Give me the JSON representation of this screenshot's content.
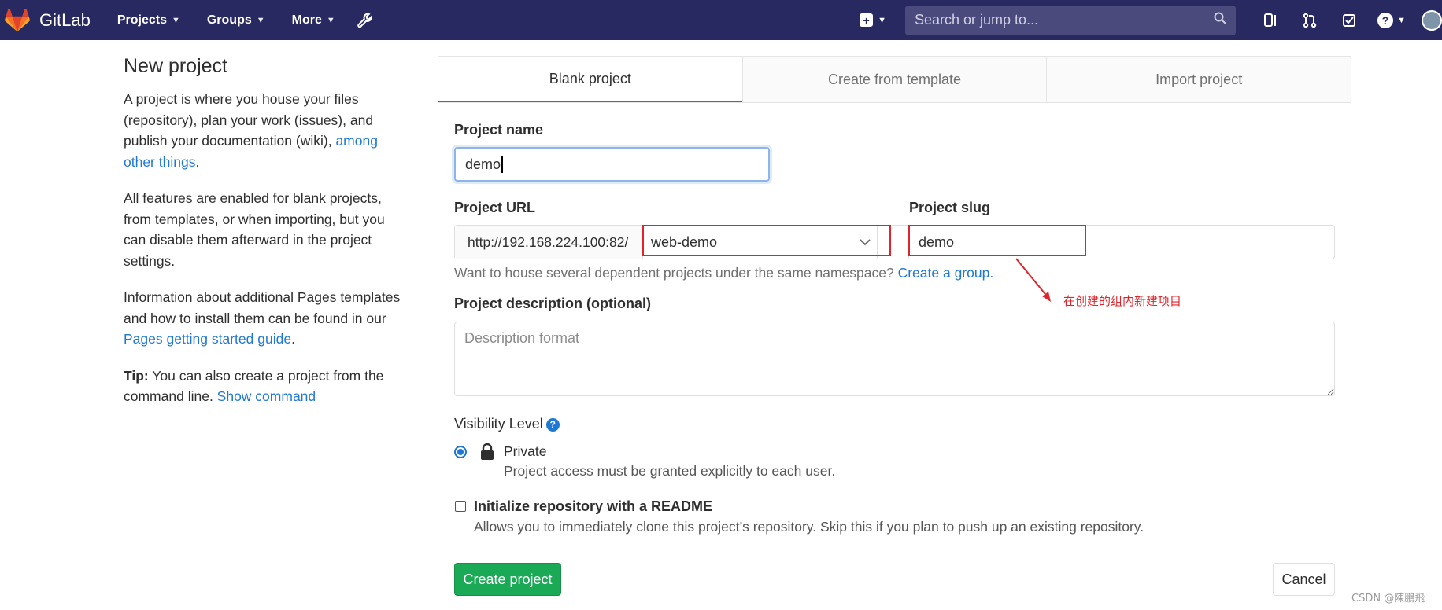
{
  "nav": {
    "brand": "GitLab",
    "projects": "Projects",
    "groups": "Groups",
    "more": "More",
    "search_placeholder": "Search or jump to..."
  },
  "sidebar": {
    "title": "New project",
    "p1_text": "A project is where you house your files (repository), plan your work (issues), and publish your documentation (wiki), ",
    "p1_link": "among other things",
    "p1_end": ".",
    "p2": "All features are enabled for blank projects, from templates, or when importing, but you can disable them afterward in the project settings.",
    "p3_text": "Information about additional Pages templates and how to install them can be found in our ",
    "p3_link": "Pages getting started guide",
    "p3_end": ".",
    "tip_label": "Tip:",
    "tip_text": " You can also create a project from the command line. ",
    "tip_link": "Show command"
  },
  "tabs": [
    "Blank project",
    "Create from template",
    "Import project"
  ],
  "form": {
    "name_label": "Project name",
    "name_value": "demo",
    "url_label": "Project URL",
    "url_prefix": "http://192.168.224.100:82/",
    "namespace": "web-demo",
    "slug_label": "Project slug",
    "slug_value": "demo",
    "help_text": "Want to house several dependent projects under the same namespace? ",
    "help_link": "Create a group.",
    "desc_label": "Project description (optional)",
    "desc_placeholder": "Description format",
    "visibility_label": "Visibility Level",
    "private_label": "Private",
    "private_help": "Project access must be granted explicitly to each user.",
    "readme_label": "Initialize repository with a README",
    "readme_help": "Allows you to immediately clone this project’s repository. Skip this if you plan to push up an existing repository.",
    "create_button": "Create project",
    "cancel_button": "Cancel"
  },
  "annotation": "在创建的组内新建项目",
  "watermark": "CSDN @陳鵬飛"
}
